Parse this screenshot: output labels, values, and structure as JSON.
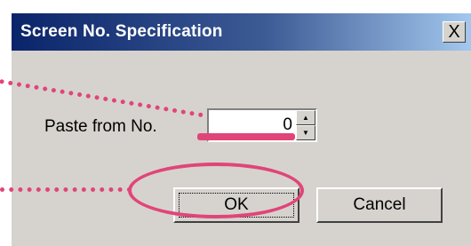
{
  "window": {
    "title": "Screen No. Specification",
    "close_label": "X"
  },
  "form": {
    "paste_label": "Paste from No.",
    "paste_value": "0",
    "ok_label": "OK",
    "cancel_label": "Cancel"
  },
  "colors": {
    "dialog_bg": "#d6d3ce",
    "title_start": "#0a246a",
    "title_end": "#a6caf0",
    "annotation": "#e0457a"
  },
  "icons": {
    "spin_up": "up-arrow-icon",
    "spin_down": "down-arrow-icon",
    "close": "close-icon"
  }
}
